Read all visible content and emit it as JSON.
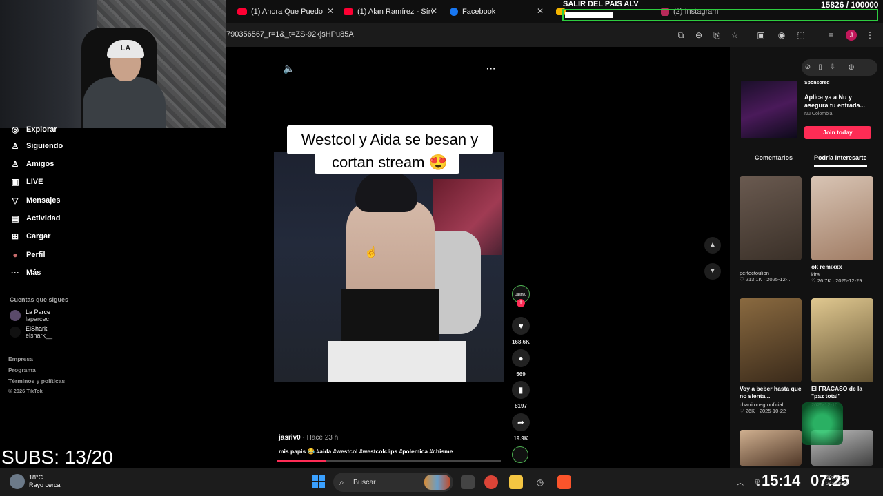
{
  "tabs": [
    {
      "label": "(1) Ahora Que Puedo",
      "color": "#ff0033"
    },
    {
      "label": "(1) Alan Ramírez - Sírv",
      "color": "#ff0033"
    },
    {
      "label": "Facebook",
      "color": "#1877f2"
    },
    {
      "label": "",
      "color": "#f4b400"
    },
    {
      "label": "(2) Instagram",
      "color": "#e1306c"
    }
  ],
  "overlay": {
    "title": "SALIR DEL PAIS ALV",
    "counter": "15826  / 100000",
    "progress": 0.158
  },
  "address_bar": {
    "url": "790356567_r=1&_t=ZS-92kjsHPu85A",
    "profile_initial": "J"
  },
  "sidebar": {
    "items": [
      {
        "label": "Explorar",
        "icon": "compass-icon",
        "glyph": "◎"
      },
      {
        "label": "Siguiendo",
        "icon": "person-icon",
        "glyph": "♙"
      },
      {
        "label": "Amigos",
        "icon": "friends-icon",
        "glyph": "♙"
      },
      {
        "label": "LIVE",
        "icon": "live-icon",
        "glyph": "▣"
      },
      {
        "label": "Mensajes",
        "icon": "send-icon",
        "glyph": "▽"
      },
      {
        "label": "Actividad",
        "icon": "activity-icon",
        "glyph": "▤"
      },
      {
        "label": "Cargar",
        "icon": "upload-icon",
        "glyph": "⊞"
      },
      {
        "label": "Perfil",
        "icon": "profile-icon",
        "glyph": "●"
      },
      {
        "label": "Más",
        "icon": "more-icon",
        "glyph": "···"
      }
    ],
    "following_title": "Cuentas que sigues",
    "following": [
      {
        "name": "La Parce",
        "handle": "laparcec"
      },
      {
        "name": "ElShark",
        "handle": "elshark__"
      }
    ],
    "footer": [
      "Empresa",
      "Programa",
      "Términos y políticas",
      "© 2026 TikTok"
    ]
  },
  "stream": {
    "subs": "SUBS: 13/20"
  },
  "video": {
    "caption_line1": "Westcol y Aida se besan y",
    "caption_line2": "cortan stream 😍",
    "creator_avatar_text": "Jasriv0",
    "likes": "168.6K",
    "comments": "569",
    "saves": "8197",
    "shares": "19.9K",
    "author": "jasriv0",
    "time": " · Hace 23 h",
    "description": "mis papis 😂 #aida #westcol #westcolclips #polemica #chisme",
    "progress": 0.22
  },
  "ad": {
    "sponsored": "Sponsored",
    "title": "Aplica ya a Nu y asegura tu entrada...",
    "brand": "Nu Colombia",
    "cta": "Join today"
  },
  "right_tabs": [
    "Comentarios",
    "Podría interesarte"
  ],
  "cards": [
    {
      "caption": "",
      "author": "perfectoulion",
      "stats": "♡ 213.1K · 2025-12-...",
      "color": "#4a4038"
    },
    {
      "caption": "ok remixxx",
      "author": "kira",
      "stats": "♡ 26.7K · 2025-12-29",
      "color": "#b08a74"
    },
    {
      "caption": "Voy a beber hasta que no sienta...",
      "author": "charritonegrooficial",
      "stats": "♡ 26K · 2025-10-22",
      "color": "#6a5030"
    },
    {
      "caption": "El FRACASO de la \"paz total\"",
      "author": "",
      "stats": "2025-12-10",
      "color": "#c0a070"
    }
  ],
  "taskbar": {
    "temp": "18°C",
    "weather": "Rayo cerca",
    "search": "Buscar",
    "clock1": "15:14",
    "clock2": "07:25",
    "small_time": "10:38 p.m.",
    "small_date": "2/01/2026"
  }
}
